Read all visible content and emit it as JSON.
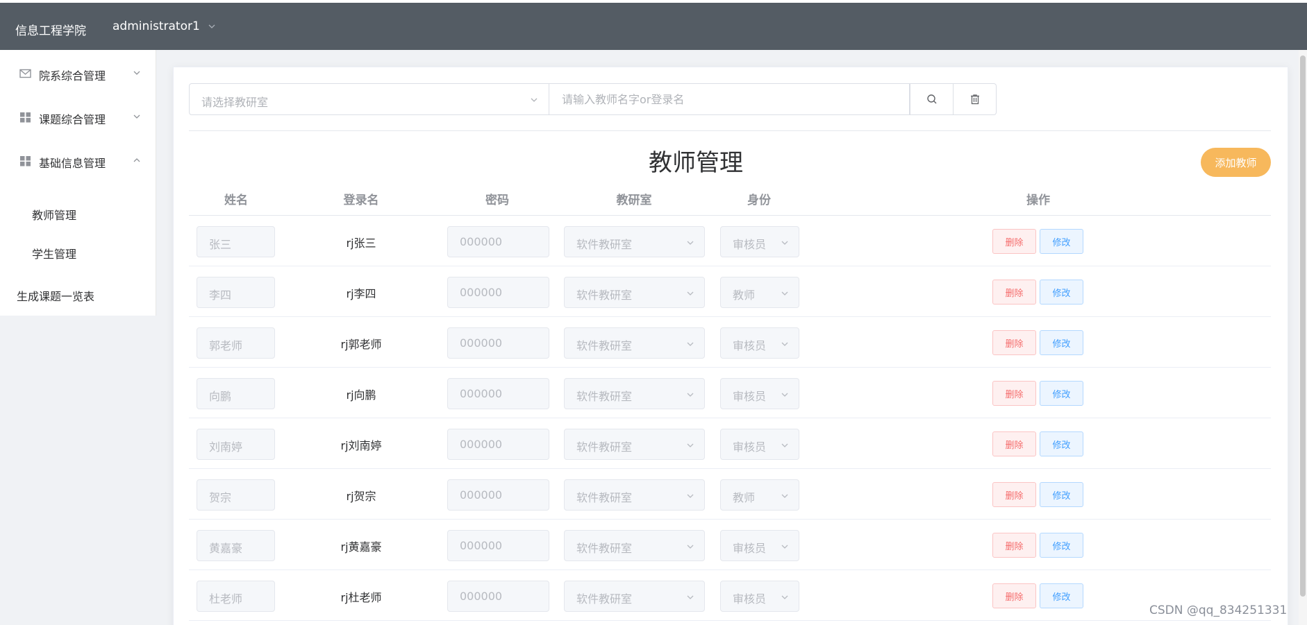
{
  "header": {
    "brand": "信息工程学院",
    "user": "administrator1"
  },
  "sidebar": {
    "menus": [
      {
        "label": "院系综合管理",
        "icon": "envelope-icon"
      },
      {
        "label": "课题综合管理",
        "icon": "grid-icon"
      },
      {
        "label": "基础信息管理",
        "icon": "grid-icon"
      }
    ],
    "sub_items": [
      "教师管理",
      "学生管理"
    ],
    "plain_item": "生成课题一览表"
  },
  "filters": {
    "dept_placeholder": "请选择教研室",
    "search_placeholder": "请输入教师名字or登录名"
  },
  "page": {
    "title": "教师管理",
    "add_button": "添加教师"
  },
  "table": {
    "columns": [
      "姓名",
      "登录名",
      "密码",
      "教研室",
      "身份",
      "操作"
    ],
    "rows": [
      {
        "name": "张三",
        "login": "rj张三",
        "password": "000000",
        "dept": "软件教研室",
        "role": "审核员"
      },
      {
        "name": "李四",
        "login": "rj李四",
        "password": "000000",
        "dept": "软件教研室",
        "role": "教师"
      },
      {
        "name": "郭老师",
        "login": "rj郭老师",
        "password": "000000",
        "dept": "软件教研室",
        "role": "审核员"
      },
      {
        "name": "向鹏",
        "login": "rj向鹏",
        "password": "000000",
        "dept": "软件教研室",
        "role": "审核员"
      },
      {
        "name": "刘南婷",
        "login": "rj刘南婷",
        "password": "000000",
        "dept": "软件教研室",
        "role": "审核员"
      },
      {
        "name": "贺宗",
        "login": "rj贺宗",
        "password": "000000",
        "dept": "软件教研室",
        "role": "教师"
      },
      {
        "name": "黄嘉豪",
        "login": "rj黄嘉豪",
        "password": "000000",
        "dept": "软件教研室",
        "role": "审核员"
      },
      {
        "name": "杜老师",
        "login": "rj杜老师",
        "password": "000000",
        "dept": "软件教研室",
        "role": "审核员"
      }
    ],
    "delete_label": "删除",
    "edit_label": "修改"
  },
  "watermark": "CSDN @qq_834251331"
}
